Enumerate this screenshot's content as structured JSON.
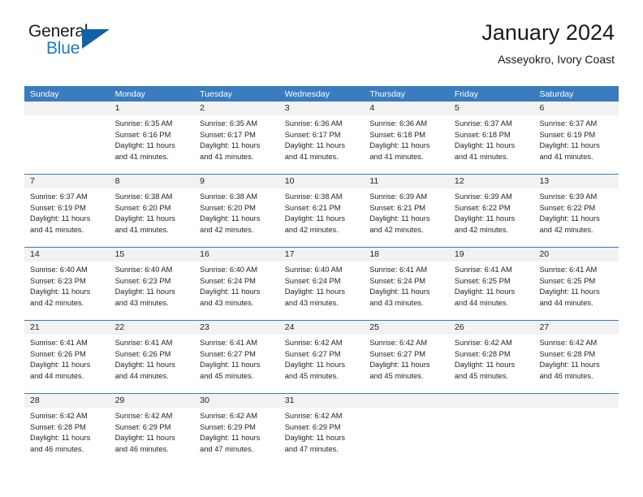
{
  "logo": {
    "word_one": "General",
    "word_two": "Blue",
    "accent_color": "#1161a9",
    "blue_text_color": "#1f7ac4"
  },
  "header": {
    "title": "January 2024",
    "subtitle": "Asseyokro, Ivory Coast"
  },
  "theme": {
    "header_row_bg": "#3a7cc0",
    "header_row_text": "#ffffff",
    "daynum_band_bg": "#f2f2f2",
    "cell_text": "#231f20",
    "grid_line": "#3a7cc0"
  },
  "weekdays": [
    "Sunday",
    "Monday",
    "Tuesday",
    "Wednesday",
    "Thursday",
    "Friday",
    "Saturday"
  ],
  "weeks": [
    [
      {
        "day": "",
        "lines": []
      },
      {
        "day": "1",
        "lines": [
          "Sunrise: 6:35 AM",
          "Sunset: 6:16 PM",
          "Daylight: 11 hours",
          "and 41 minutes."
        ]
      },
      {
        "day": "2",
        "lines": [
          "Sunrise: 6:35 AM",
          "Sunset: 6:17 PM",
          "Daylight: 11 hours",
          "and 41 minutes."
        ]
      },
      {
        "day": "3",
        "lines": [
          "Sunrise: 6:36 AM",
          "Sunset: 6:17 PM",
          "Daylight: 11 hours",
          "and 41 minutes."
        ]
      },
      {
        "day": "4",
        "lines": [
          "Sunrise: 6:36 AM",
          "Sunset: 6:18 PM",
          "Daylight: 11 hours",
          "and 41 minutes."
        ]
      },
      {
        "day": "5",
        "lines": [
          "Sunrise: 6:37 AM",
          "Sunset: 6:18 PM",
          "Daylight: 11 hours",
          "and 41 minutes."
        ]
      },
      {
        "day": "6",
        "lines": [
          "Sunrise: 6:37 AM",
          "Sunset: 6:19 PM",
          "Daylight: 11 hours",
          "and 41 minutes."
        ]
      }
    ],
    [
      {
        "day": "7",
        "lines": [
          "Sunrise: 6:37 AM",
          "Sunset: 6:19 PM",
          "Daylight: 11 hours",
          "and 41 minutes."
        ]
      },
      {
        "day": "8",
        "lines": [
          "Sunrise: 6:38 AM",
          "Sunset: 6:20 PM",
          "Daylight: 11 hours",
          "and 41 minutes."
        ]
      },
      {
        "day": "9",
        "lines": [
          "Sunrise: 6:38 AM",
          "Sunset: 6:20 PM",
          "Daylight: 11 hours",
          "and 42 minutes."
        ]
      },
      {
        "day": "10",
        "lines": [
          "Sunrise: 6:38 AM",
          "Sunset: 6:21 PM",
          "Daylight: 11 hours",
          "and 42 minutes."
        ]
      },
      {
        "day": "11",
        "lines": [
          "Sunrise: 6:39 AM",
          "Sunset: 6:21 PM",
          "Daylight: 11 hours",
          "and 42 minutes."
        ]
      },
      {
        "day": "12",
        "lines": [
          "Sunrise: 6:39 AM",
          "Sunset: 6:22 PM",
          "Daylight: 11 hours",
          "and 42 minutes."
        ]
      },
      {
        "day": "13",
        "lines": [
          "Sunrise: 6:39 AM",
          "Sunset: 6:22 PM",
          "Daylight: 11 hours",
          "and 42 minutes."
        ]
      }
    ],
    [
      {
        "day": "14",
        "lines": [
          "Sunrise: 6:40 AM",
          "Sunset: 6:23 PM",
          "Daylight: 11 hours",
          "and 42 minutes."
        ]
      },
      {
        "day": "15",
        "lines": [
          "Sunrise: 6:40 AM",
          "Sunset: 6:23 PM",
          "Daylight: 11 hours",
          "and 43 minutes."
        ]
      },
      {
        "day": "16",
        "lines": [
          "Sunrise: 6:40 AM",
          "Sunset: 6:24 PM",
          "Daylight: 11 hours",
          "and 43 minutes."
        ]
      },
      {
        "day": "17",
        "lines": [
          "Sunrise: 6:40 AM",
          "Sunset: 6:24 PM",
          "Daylight: 11 hours",
          "and 43 minutes."
        ]
      },
      {
        "day": "18",
        "lines": [
          "Sunrise: 6:41 AM",
          "Sunset: 6:24 PM",
          "Daylight: 11 hours",
          "and 43 minutes."
        ]
      },
      {
        "day": "19",
        "lines": [
          "Sunrise: 6:41 AM",
          "Sunset: 6:25 PM",
          "Daylight: 11 hours",
          "and 44 minutes."
        ]
      },
      {
        "day": "20",
        "lines": [
          "Sunrise: 6:41 AM",
          "Sunset: 6:25 PM",
          "Daylight: 11 hours",
          "and 44 minutes."
        ]
      }
    ],
    [
      {
        "day": "21",
        "lines": [
          "Sunrise: 6:41 AM",
          "Sunset: 6:26 PM",
          "Daylight: 11 hours",
          "and 44 minutes."
        ]
      },
      {
        "day": "22",
        "lines": [
          "Sunrise: 6:41 AM",
          "Sunset: 6:26 PM",
          "Daylight: 11 hours",
          "and 44 minutes."
        ]
      },
      {
        "day": "23",
        "lines": [
          "Sunrise: 6:41 AM",
          "Sunset: 6:27 PM",
          "Daylight: 11 hours",
          "and 45 minutes."
        ]
      },
      {
        "day": "24",
        "lines": [
          "Sunrise: 6:42 AM",
          "Sunset: 6:27 PM",
          "Daylight: 11 hours",
          "and 45 minutes."
        ]
      },
      {
        "day": "25",
        "lines": [
          "Sunrise: 6:42 AM",
          "Sunset: 6:27 PM",
          "Daylight: 11 hours",
          "and 45 minutes."
        ]
      },
      {
        "day": "26",
        "lines": [
          "Sunrise: 6:42 AM",
          "Sunset: 6:28 PM",
          "Daylight: 11 hours",
          "and 45 minutes."
        ]
      },
      {
        "day": "27",
        "lines": [
          "Sunrise: 6:42 AM",
          "Sunset: 6:28 PM",
          "Daylight: 11 hours",
          "and 46 minutes."
        ]
      }
    ],
    [
      {
        "day": "28",
        "lines": [
          "Sunrise: 6:42 AM",
          "Sunset: 6:28 PM",
          "Daylight: 11 hours",
          "and 46 minutes."
        ]
      },
      {
        "day": "29",
        "lines": [
          "Sunrise: 6:42 AM",
          "Sunset: 6:29 PM",
          "Daylight: 11 hours",
          "and 46 minutes."
        ]
      },
      {
        "day": "30",
        "lines": [
          "Sunrise: 6:42 AM",
          "Sunset: 6:29 PM",
          "Daylight: 11 hours",
          "and 47 minutes."
        ]
      },
      {
        "day": "31",
        "lines": [
          "Sunrise: 6:42 AM",
          "Sunset: 6:29 PM",
          "Daylight: 11 hours",
          "and 47 minutes."
        ]
      },
      {
        "day": "",
        "lines": []
      },
      {
        "day": "",
        "lines": []
      },
      {
        "day": "",
        "lines": []
      }
    ]
  ]
}
